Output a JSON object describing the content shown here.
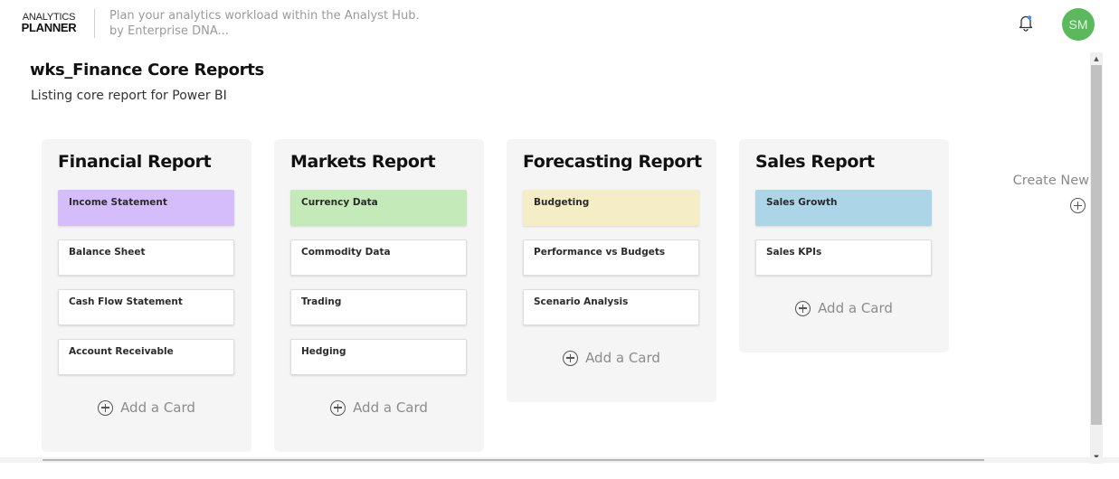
{
  "header": {
    "logo_top": "ANALYTICS",
    "logo_bottom": "PLANNER",
    "tagline_line1": "Plan your analytics workload within the Analyst Hub.",
    "tagline_line2": "by Enterprise DNA...",
    "notification_icon": "bell-icon",
    "notification_dot_color": "#4a90e2",
    "avatar_initials": "SM",
    "avatar_color": "#5cb85c"
  },
  "workspace": {
    "title": "wks_Finance Core Reports",
    "description": "Listing core report for Power BI"
  },
  "lists": [
    {
      "title": "Financial Report",
      "cards": [
        {
          "label": "Income Statement",
          "color": "#d5bdfb"
        },
        {
          "label": "Balance Sheet",
          "color": "#ffffff"
        },
        {
          "label": "Cash Flow Statement",
          "color": "#ffffff"
        },
        {
          "label": "Account Receivable",
          "color": "#ffffff"
        }
      ],
      "add_label": "Add a Card"
    },
    {
      "title": "Markets Report",
      "cards": [
        {
          "label": "Currency Data",
          "color": "#c5eab9"
        },
        {
          "label": "Commodity Data",
          "color": "#ffffff"
        },
        {
          "label": "Trading",
          "color": "#ffffff"
        },
        {
          "label": "Hedging",
          "color": "#ffffff"
        }
      ],
      "add_label": "Add a Card"
    },
    {
      "title": "Forecasting Report",
      "cards": [
        {
          "label": "Budgeting",
          "color": "#f5edc6"
        },
        {
          "label": "Performance vs Budgets",
          "color": "#ffffff"
        },
        {
          "label": "Scenario Analysis",
          "color": "#ffffff"
        }
      ],
      "add_label": "Add a Card"
    },
    {
      "title": "Sales Report",
      "cards": [
        {
          "label": "Sales Growth",
          "color": "#acd5e8"
        },
        {
          "label": "Sales KPIs",
          "color": "#ffffff"
        }
      ],
      "add_label": "Add a Card"
    }
  ],
  "create_new_label": "Create New",
  "icons": {
    "add": "plus-circle-icon",
    "scroll_up": "caret-up-icon",
    "scroll_down": "caret-down-icon"
  }
}
